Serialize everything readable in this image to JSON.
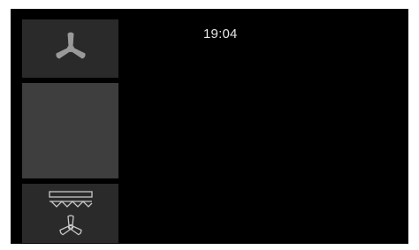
{
  "status": {
    "time": "19:04"
  },
  "sidebar": {
    "buttons": [
      {
        "id": "fan",
        "icon": "fan-icon"
      },
      {
        "id": "blank",
        "icon": ""
      },
      {
        "id": "ceiling-vent-fan",
        "icon": "ceiling-vent-fan-icon"
      }
    ]
  },
  "colors": {
    "background": "#000000",
    "button": "#2a2a2a",
    "button_selected": "#3e3e3e",
    "icon": "#9a9a9a",
    "text": "#e8e8e8"
  }
}
